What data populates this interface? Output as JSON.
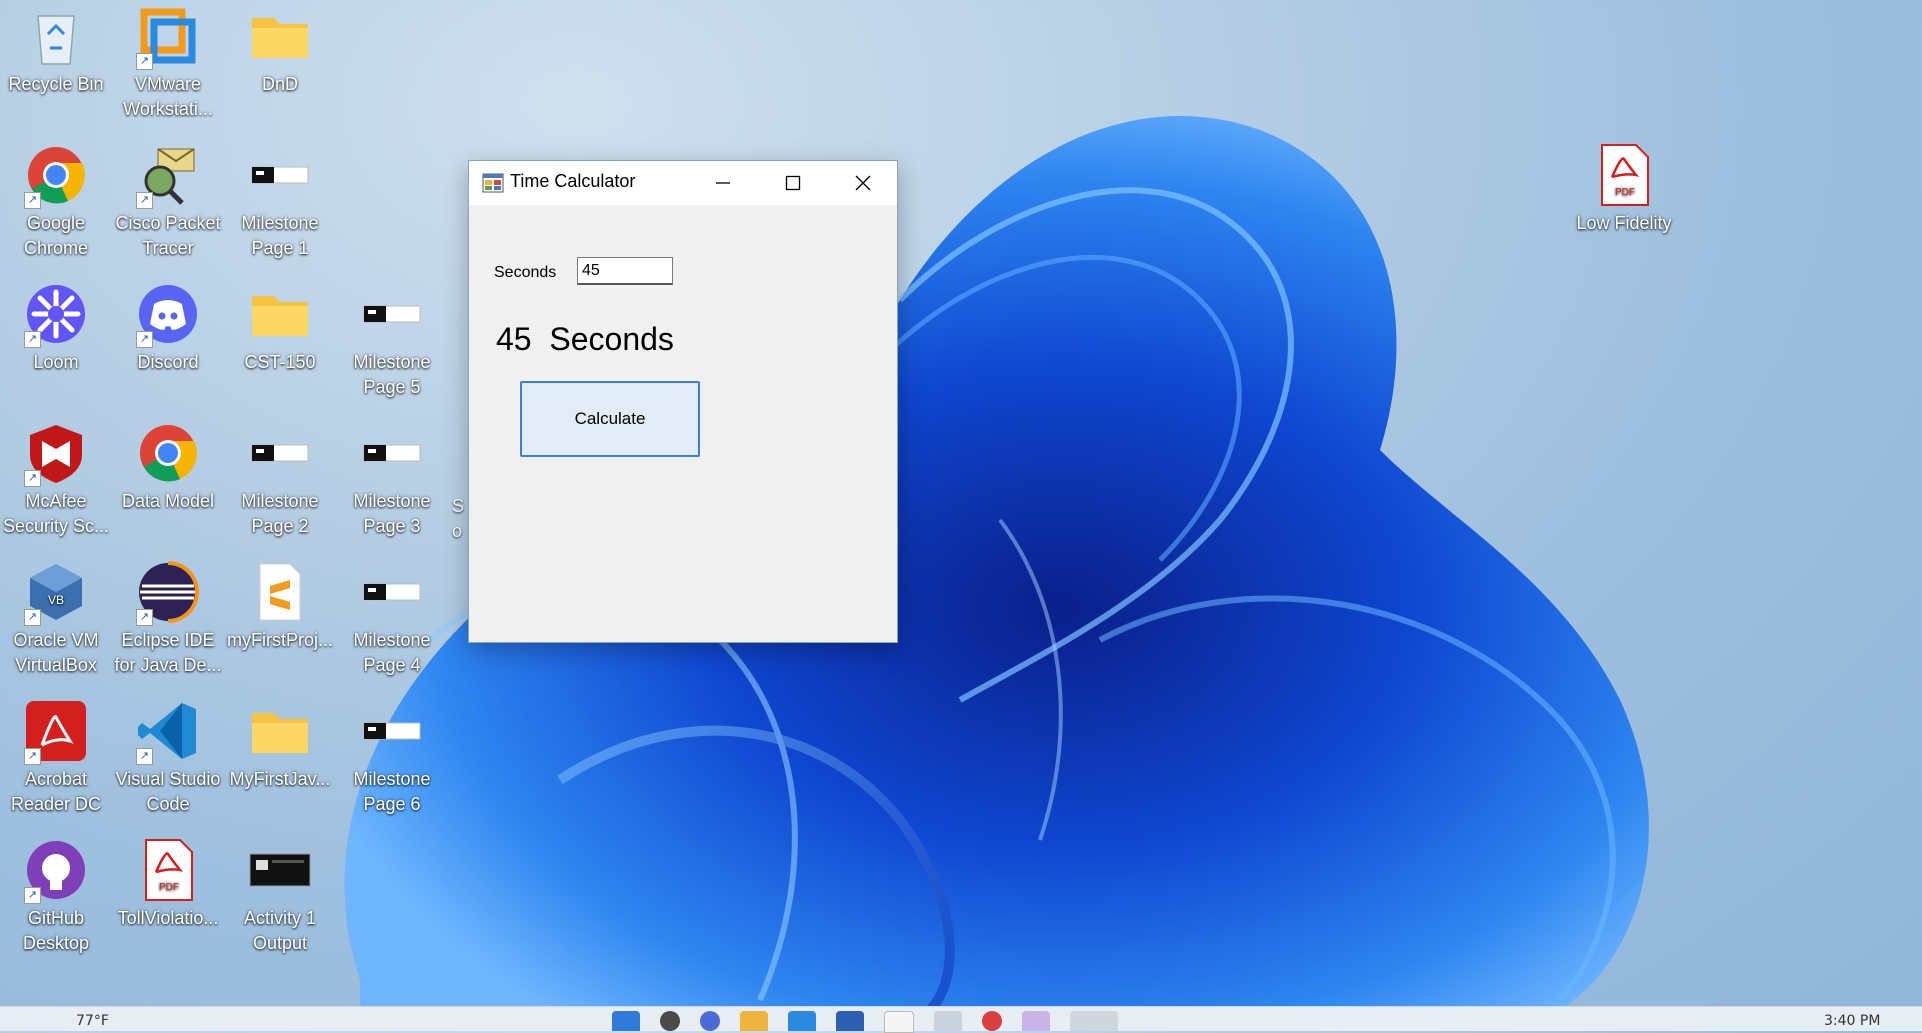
{
  "desktop": {
    "icons": [
      {
        "name": "recycle-bin",
        "label": "Recycle Bin",
        "icon": "recycle-bin-icon",
        "shortcut": false
      },
      {
        "name": "vmware",
        "label": "VMware Workstati...",
        "icon": "vmware-icon",
        "shortcut": true
      },
      {
        "name": "dnd",
        "label": "DnD",
        "icon": "folder-icon",
        "shortcut": false
      },
      {
        "name": "google-chrome",
        "label": "Google Chrome",
        "icon": "chrome-icon",
        "shortcut": true
      },
      {
        "name": "cisco-packet-tracer",
        "label": "Cisco Packet Tracer",
        "icon": "cisco-icon",
        "shortcut": true
      },
      {
        "name": "milestone-page-1",
        "label": "Milestone Page 1",
        "icon": "image-file-icon",
        "shortcut": false
      },
      {
        "name": "loom",
        "label": "Loom",
        "icon": "loom-icon",
        "shortcut": true
      },
      {
        "name": "discord",
        "label": "Discord",
        "icon": "discord-icon",
        "shortcut": true
      },
      {
        "name": "cst-150",
        "label": "CST-150",
        "icon": "folder-icon",
        "shortcut": false
      },
      {
        "name": "milestone-page-5",
        "label": "Milestone Page 5",
        "icon": "image-file-icon",
        "shortcut": false
      },
      {
        "name": "mcafee",
        "label": "McAfee Security Sc...",
        "icon": "mcafee-icon",
        "shortcut": true
      },
      {
        "name": "data-model",
        "label": "Data Model",
        "icon": "chrome-icon",
        "shortcut": false
      },
      {
        "name": "milestone-page-2",
        "label": "Milestone Page 2",
        "icon": "image-file-icon",
        "shortcut": false
      },
      {
        "name": "milestone-page-3",
        "label": "Milestone Page 3",
        "icon": "image-file-icon",
        "shortcut": false
      },
      {
        "name": "oracle-vm",
        "label": "Oracle VM VirtualBox",
        "icon": "virtualbox-icon",
        "shortcut": true
      },
      {
        "name": "eclipse",
        "label": "Eclipse IDE for Java De...",
        "icon": "eclipse-icon",
        "shortcut": true
      },
      {
        "name": "myfirstproj",
        "label": "myFirstProj...",
        "icon": "sublime-file-icon",
        "shortcut": false
      },
      {
        "name": "milestone-page-4",
        "label": "Milestone Page 4",
        "icon": "image-file-icon",
        "shortcut": false
      },
      {
        "name": "acrobat",
        "label": "Acrobat Reader DC",
        "icon": "acrobat-icon",
        "shortcut": true
      },
      {
        "name": "vscode",
        "label": "Visual Studio Code",
        "icon": "vscode-icon",
        "shortcut": true
      },
      {
        "name": "myfirstjav",
        "label": "MyFirstJav...",
        "icon": "folder-icon",
        "shortcut": false
      },
      {
        "name": "milestone-page-6",
        "label": "Milestone Page 6",
        "icon": "image-file-icon",
        "shortcut": false
      },
      {
        "name": "github-desktop",
        "label": "GitHub Desktop",
        "icon": "github-icon",
        "shortcut": true
      },
      {
        "name": "tollviolation",
        "label": "TollViolatio...",
        "icon": "pdf-file-icon",
        "shortcut": false
      },
      {
        "name": "activity-1-output",
        "label": "Activity 1 Output",
        "icon": "screenshot-file-icon",
        "shortcut": false
      },
      {
        "name": "low-fidelity",
        "label": "Low Fidelity",
        "icon": "pdf-file-icon",
        "shortcut": false
      }
    ],
    "partial_label": "S\no"
  },
  "window": {
    "title": "Time Calculator",
    "app_icon": "app-form-icon",
    "seconds_label": "Seconds",
    "seconds_value": "45",
    "result_text": "45  Seconds",
    "calculate_label": "Calculate",
    "controls": {
      "minimize": "minimize-icon",
      "maximize": "maximize-icon",
      "close": "close-icon"
    }
  },
  "taskbar": {
    "left_text": "77°F",
    "right_text": "3:40 PM"
  },
  "colors": {
    "accent": "#3c7fd1",
    "window_bg": "#f0f0f0",
    "button_bg": "#e1ecf8"
  }
}
